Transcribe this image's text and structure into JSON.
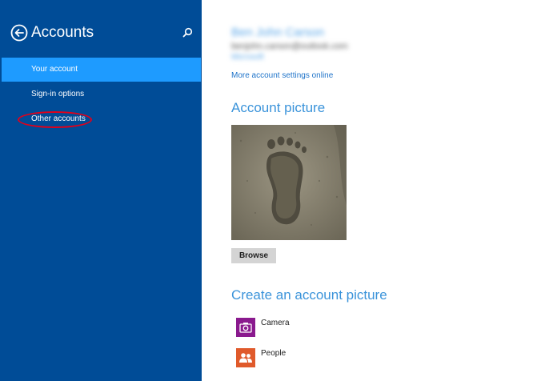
{
  "sidebar": {
    "title": "Accounts",
    "items": [
      {
        "label": "Your account"
      },
      {
        "label": "Sign-in options"
      },
      {
        "label": "Other accounts"
      }
    ],
    "active_index": 0
  },
  "account": {
    "name": "Ben John Carson",
    "email": "benjohn.carson@outlook.com",
    "sub": "Microsoft",
    "settings_link": "More account settings online"
  },
  "picture_section": {
    "title": "Account picture",
    "browse_label": "Browse"
  },
  "create_section": {
    "title": "Create an account picture",
    "apps": [
      {
        "label": "Camera",
        "icon": "camera-icon",
        "color": "#8a1a8e"
      },
      {
        "label": "People",
        "icon": "people-icon",
        "color": "#e05a2b"
      }
    ]
  },
  "colors": {
    "sidebar_bg": "#004c97",
    "active_item": "#1e9bff",
    "accent_text": "#3a93da",
    "highlight_ring": "#e1001a"
  }
}
